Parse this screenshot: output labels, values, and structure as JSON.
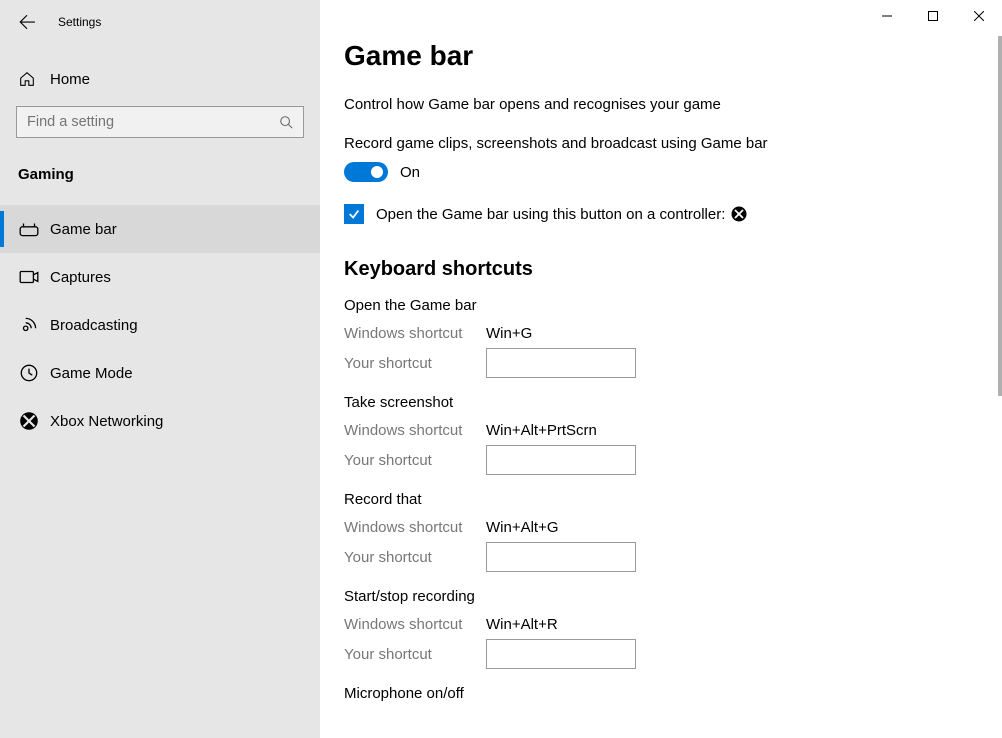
{
  "window": {
    "app_title": "Settings"
  },
  "sidebar": {
    "home_label": "Home",
    "search_placeholder": "Find a setting",
    "category": "Gaming",
    "items": [
      {
        "label": "Game bar"
      },
      {
        "label": "Captures"
      },
      {
        "label": "Broadcasting"
      },
      {
        "label": "Game Mode"
      },
      {
        "label": "Xbox Networking"
      }
    ]
  },
  "main": {
    "title": "Game bar",
    "description": "Control how Game bar opens and recognises your game",
    "toggle_label": "Record game clips, screenshots and broadcast using Game bar",
    "toggle_state": "On",
    "checkbox_label": "Open the Game bar using this button on a controller:",
    "shortcuts_title": "Keyboard shortcuts",
    "row_labels": {
      "windows": "Windows shortcut",
      "your": "Your shortcut"
    },
    "shortcuts": [
      {
        "name": "Open the Game bar",
        "win": "Win+G",
        "user": ""
      },
      {
        "name": "Take screenshot",
        "win": "Win+Alt+PrtScrn",
        "user": ""
      },
      {
        "name": "Record that",
        "win": "Win+Alt+G",
        "user": ""
      },
      {
        "name": "Start/stop recording",
        "win": "Win+Alt+R",
        "user": ""
      },
      {
        "name": "Microphone on/off",
        "win": "",
        "user": ""
      }
    ]
  }
}
